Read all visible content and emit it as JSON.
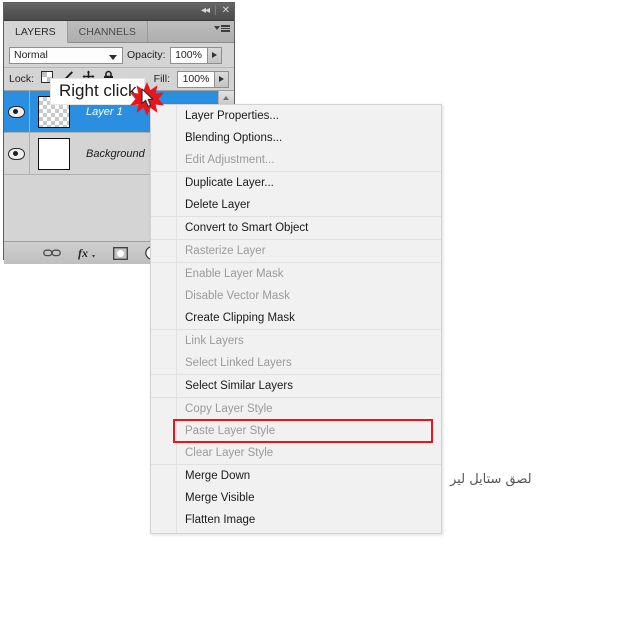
{
  "panel": {
    "titlebar": {
      "collapse_icon": "collapse-double-arrow",
      "collapse_glyph": "◂◂",
      "close_glyph": "✕",
      "separator": "|"
    },
    "tabs": [
      {
        "label": "LAYERS",
        "active": true
      },
      {
        "label": "CHANNELS",
        "active": false
      }
    ],
    "menu_button_name": "panel-options-menu",
    "blend_row": {
      "blend_mode": "Normal",
      "opacity_label": "Opacity:",
      "opacity_value": "100%"
    },
    "lock_row": {
      "lock_label": "Lock:",
      "lock_icons": [
        "lock-transparent-pixels-icon",
        "lock-image-pixels-icon",
        "lock-position-icon",
        "lock-all-icon"
      ],
      "fill_label": "Fill:",
      "fill_value": "100%"
    },
    "layers": [
      {
        "name": "Layer 1",
        "selected": true,
        "thumb": "checker",
        "visible": true
      },
      {
        "name": "Background",
        "selected": false,
        "thumb": "white",
        "visible": true
      }
    ],
    "footer_icons": [
      "link-layers-icon",
      "add-layer-style-fx-icon",
      "add-layer-mask-icon",
      "new-adjustment-layer-icon",
      "new-layer-icon"
    ],
    "footer_fx_label": "fx"
  },
  "tooltip": {
    "text": "Right click",
    "star_icon": "red-starburst-icon",
    "cursor_icon": "mouse-pointer-icon"
  },
  "context_menu": {
    "groups": [
      {
        "items": [
          {
            "label": "Layer Properties...",
            "disabled": false,
            "highlighted": false
          },
          {
            "label": "Blending Options...",
            "disabled": false,
            "highlighted": false
          },
          {
            "label": "Edit Adjustment...",
            "disabled": true,
            "highlighted": false
          }
        ]
      },
      {
        "items": [
          {
            "label": "Duplicate Layer...",
            "disabled": false,
            "highlighted": false
          },
          {
            "label": "Delete Layer",
            "disabled": false,
            "highlighted": false
          }
        ]
      },
      {
        "items": [
          {
            "label": "Convert to Smart Object",
            "disabled": false,
            "highlighted": false
          }
        ]
      },
      {
        "items": [
          {
            "label": "Rasterize Layer",
            "disabled": true,
            "highlighted": false
          }
        ]
      },
      {
        "items": [
          {
            "label": "Enable Layer Mask",
            "disabled": true,
            "highlighted": false
          },
          {
            "label": "Disable Vector Mask",
            "disabled": true,
            "highlighted": false
          },
          {
            "label": "Create Clipping Mask",
            "disabled": false,
            "highlighted": false
          }
        ]
      },
      {
        "items": [
          {
            "label": "Link Layers",
            "disabled": true,
            "highlighted": false
          },
          {
            "label": "Select Linked Layers",
            "disabled": true,
            "highlighted": false
          }
        ]
      },
      {
        "items": [
          {
            "label": "Select Similar Layers",
            "disabled": false,
            "highlighted": false
          }
        ]
      },
      {
        "items": [
          {
            "label": "Copy Layer Style",
            "disabled": true,
            "highlighted": false
          },
          {
            "label": "Paste Layer Style",
            "disabled": true,
            "highlighted": true
          },
          {
            "label": "Clear Layer Style",
            "disabled": true,
            "highlighted": false
          }
        ]
      },
      {
        "items": [
          {
            "label": "Merge Down",
            "disabled": false,
            "highlighted": false
          },
          {
            "label": "Merge Visible",
            "disabled": false,
            "highlighted": false
          },
          {
            "label": "Flatten Image",
            "disabled": false,
            "highlighted": false
          }
        ]
      }
    ]
  },
  "annotation": {
    "arabic_caption": "لصق ستايل لير"
  },
  "colors": {
    "selection_blue": "#2a8fe0",
    "highlight_red": "#e8151b",
    "panel_gray": "#d4d4d4",
    "menu_bg": "#f1f1f1",
    "disabled_text": "#9a9a9a",
    "star_red": "#e8151b"
  }
}
